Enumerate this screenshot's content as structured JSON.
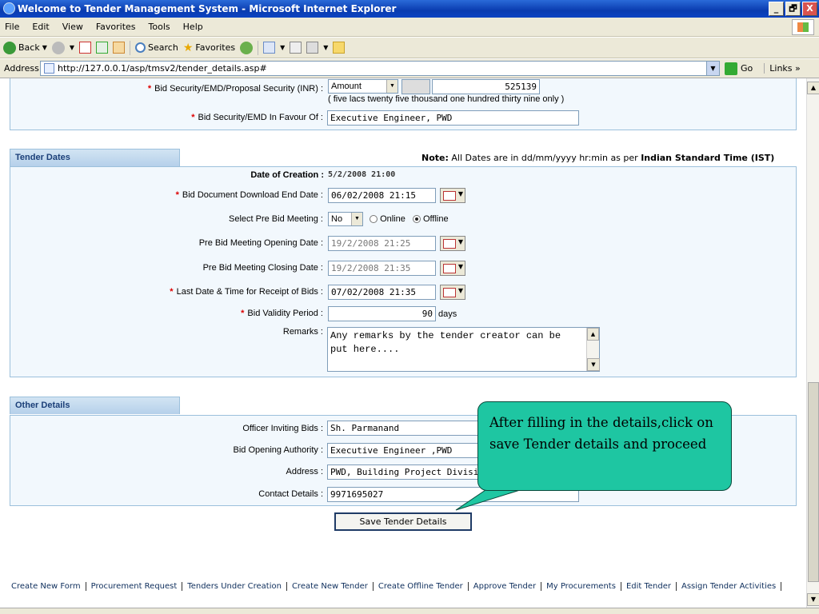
{
  "window": {
    "title": "Welcome to Tender Management System - Microsoft Internet Explorer",
    "buttons": [
      "_",
      "🗗",
      "X"
    ]
  },
  "menu": [
    "File",
    "Edit",
    "View",
    "Favorites",
    "Tools",
    "Help"
  ],
  "toolbar": {
    "back": "Back",
    "search": "Search",
    "favorites": "Favorites"
  },
  "address": {
    "label": "Address",
    "url": "http://127.0.0.1/asp/tmsv2/tender_details.asp#",
    "go": "Go",
    "links": "Links »"
  },
  "security": {
    "label": "Bid Security/EMD/Proposal Security (INR) :",
    "type_value": "Amount",
    "amount_value": "525139",
    "amount_words": "( five lacs twenty five thousand one hundred thirty nine only )",
    "favour_label": "Bid Security/EMD In Favour Of :",
    "favour_value": "Executive Engineer, PWD"
  },
  "dates": {
    "header": "Tender Dates",
    "note_bold": "Note:",
    "note_text": "All Dates are in dd/mm/yyyy hr:min as per",
    "note_ist": "Indian Standard Time (IST)",
    "creation_label": "Date of Creation :",
    "creation_value": "5/2/2008 21:00",
    "download_label": "Bid Document Download End Date :",
    "download_value": "06/02/2008 21:15",
    "prebid_label": "Select Pre Bid Meeting :",
    "prebid_value": "No",
    "online": "Online",
    "offline": "Offline",
    "opening_label": "Pre Bid Meeting Opening Date :",
    "opening_value": "19/2/2008 21:25",
    "closing_label": "Pre Bid Meeting Closing Date :",
    "closing_value": "19/2/2008 21:35",
    "receipt_label": "Last Date & Time for Receipt of Bids :",
    "receipt_value": "07/02/2008 21:35",
    "validity_label": "Bid Validity Period :",
    "validity_value": "90",
    "validity_unit": "days",
    "remarks_label": "Remarks :",
    "remarks_value": "Any remarks by the tender creator can be put here...."
  },
  "other": {
    "header": "Other Details",
    "officer_label": "Officer Inviting Bids :",
    "officer_value": "Sh. Parmanand",
    "authority_label": "Bid Opening Authority :",
    "authority_value": "Executive Engineer ,PWD",
    "address_label": "Address :",
    "address_value": "PWD, Building Project Division M",
    "contact_label": "Contact Details :",
    "contact_value": "9971695027"
  },
  "save_button": "Save Tender Details",
  "callout": "After filling in  the details,click on save Tender details and proceed",
  "footer_links": [
    "Create New Form",
    "Procurement Request",
    "Tenders Under Creation",
    "Create New Tender",
    "Create Offline Tender",
    "Approve Tender",
    "My Procurements",
    "Edit Tender",
    "Assign Tender Activities"
  ]
}
